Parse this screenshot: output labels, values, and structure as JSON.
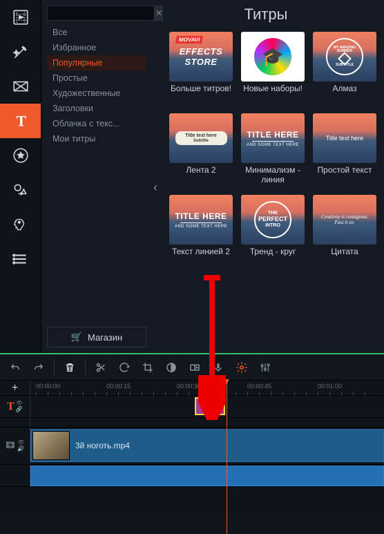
{
  "panel_title": "Титры",
  "search_placeholder": "",
  "categories": [
    {
      "label": "Все",
      "selected": false
    },
    {
      "label": "Избранное",
      "selected": false
    },
    {
      "label": "Популярные",
      "selected": true
    },
    {
      "label": "Простые",
      "selected": false
    },
    {
      "label": "Художественные",
      "selected": false
    },
    {
      "label": "Заголовки",
      "selected": false
    },
    {
      "label": "Облачка с текс...",
      "selected": false
    },
    {
      "label": "Мои титры",
      "selected": false
    }
  ],
  "shop_label": "Магазин",
  "presets": [
    {
      "label": "Больше титров!",
      "kind": "effects",
      "badge": "MOVAVI",
      "l1": "EFFECTS",
      "l2": "STORE"
    },
    {
      "label": "Новые наборы!",
      "kind": "disc",
      "glyph": "🎓"
    },
    {
      "label": "Алмаз",
      "kind": "circle-diamond",
      "top": "MY AMAZING SUMMER",
      "bot": "SUB TITLE"
    },
    {
      "label": "Лента 2",
      "kind": "ribbon",
      "l1": "Title text here",
      "l2": "Subtitle"
    },
    {
      "label": "Минимализм - линия",
      "kind": "titleline",
      "l1": "TITLE HERE",
      "l2": "AND SOME TEXT HERE"
    },
    {
      "label": "Простой текст",
      "kind": "plain",
      "l1": "Title text here"
    },
    {
      "label": "Текст линией 2",
      "kind": "titleline",
      "l1": "TITLE HERE",
      "l2": "AND SOME TEXT HERE"
    },
    {
      "label": "Тренд - круг",
      "kind": "circle-text",
      "l1": "THE",
      "l2": "PERFECT",
      "l3": "INTRO"
    },
    {
      "label": "Цитата",
      "kind": "quote",
      "l1": "Creativity is contagious.",
      "l2": "Pass it on."
    }
  ],
  "timeline": {
    "ticks": [
      "00:00:00",
      "00:00:15",
      "00:00:30",
      "00:00:45",
      "00:01:00"
    ],
    "clip_name": "3й ноготь.mp4",
    "title_clip_label": "Tᴛ"
  }
}
